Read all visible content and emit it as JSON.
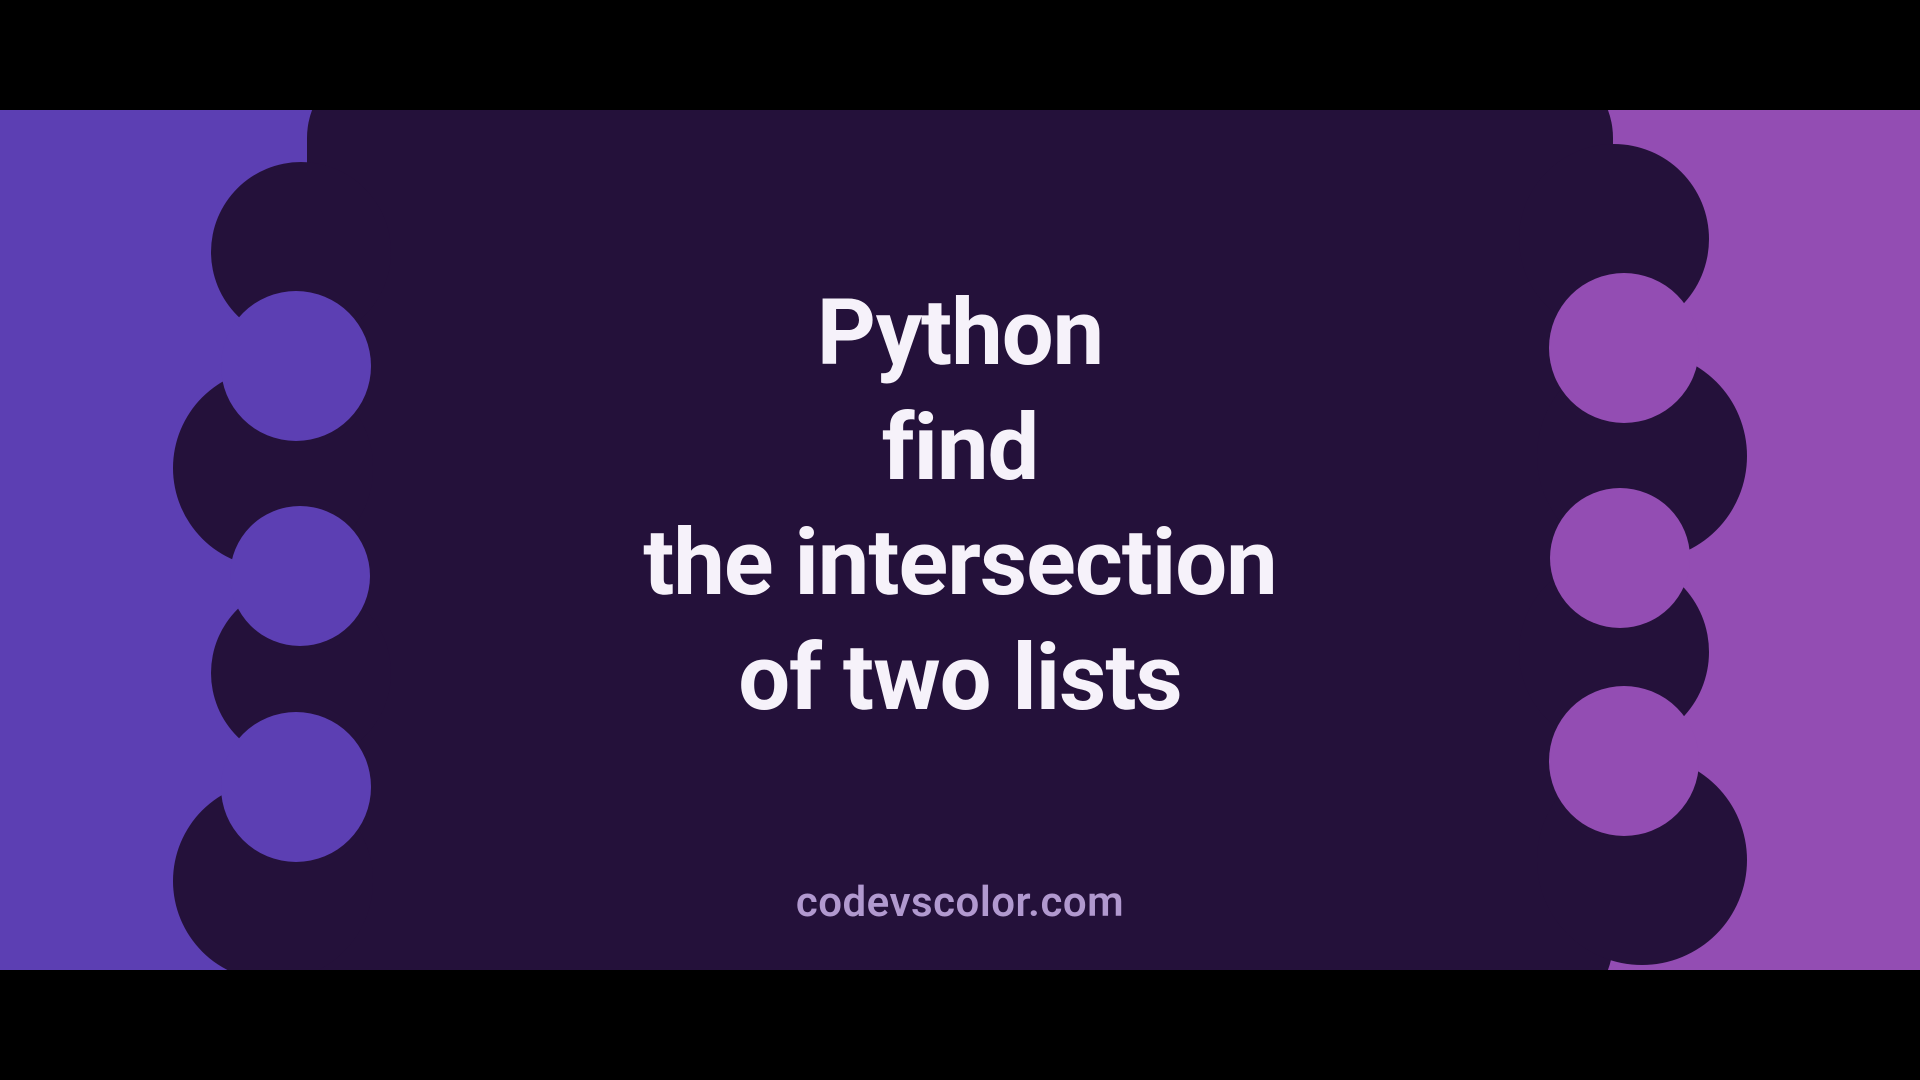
{
  "colors": {
    "left": "#5c3fb3",
    "right": "#934db3",
    "blob": "#24113a",
    "title": "#f6f2fa",
    "watermark": "#b199cf"
  },
  "title_lines": [
    "Python",
    "find",
    "the intersection",
    "of two lists"
  ],
  "watermark": "codevscolor.com"
}
